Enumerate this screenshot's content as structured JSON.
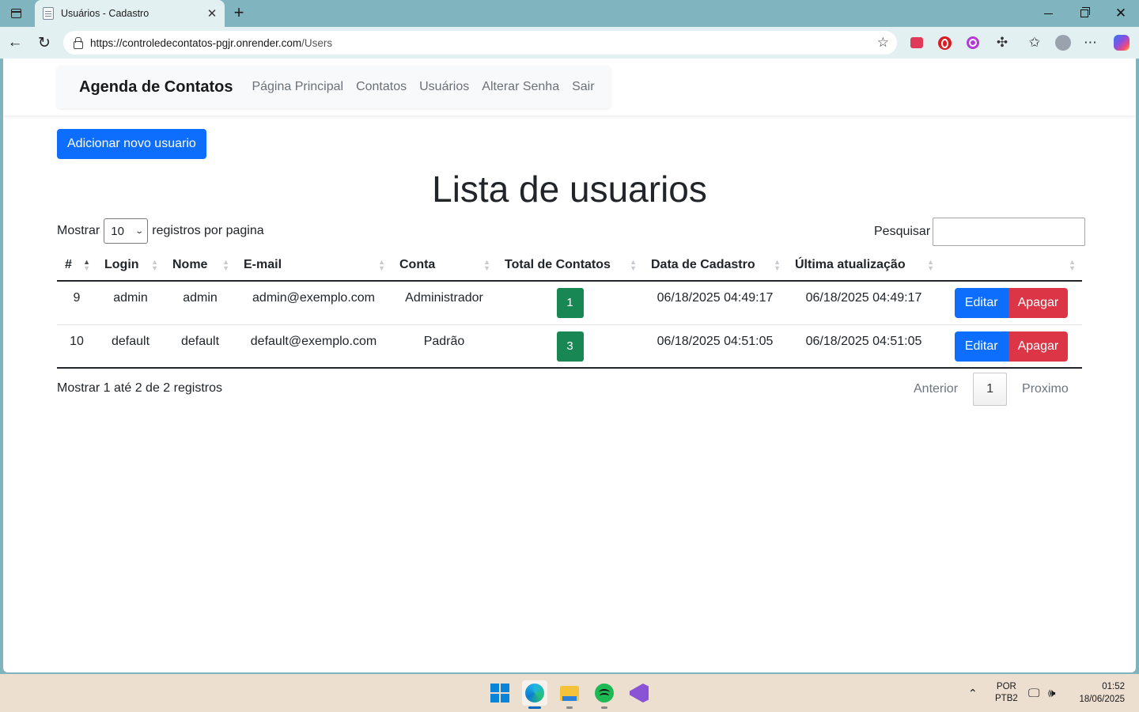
{
  "browser": {
    "tab_title": "Usuários - Cadastro",
    "url_host": "https://controledecontatos-pgjr.onrender.com",
    "url_path": "/Users"
  },
  "navbar": {
    "brand": "Agenda de Contatos",
    "links": [
      "Página Principal",
      "Contatos",
      "Usuários",
      "Alterar Senha",
      "Sair"
    ]
  },
  "main": {
    "add_button": "Adicionar novo usuario",
    "title": "Lista de usuarios",
    "length_prefix": "Mostrar",
    "length_value": "10",
    "length_suffix": "registros por pagina",
    "search_label": "Pesquisar",
    "search_value": ""
  },
  "table": {
    "headers": [
      "#",
      "Login",
      "Nome",
      "E-mail",
      "Conta",
      "Total de Contatos",
      "Data de Cadastro",
      "Última atualização",
      ""
    ],
    "rows": [
      {
        "id": "9",
        "login": "admin",
        "nome": "admin",
        "email": "admin@exemplo.com",
        "conta": "Administrador",
        "total": "1",
        "cadastro": "06/18/2025 04:49:17",
        "atualizacao": "06/18/2025 04:49:17",
        "edit": "Editar",
        "delete": "Apagar"
      },
      {
        "id": "10",
        "login": "default",
        "nome": "default",
        "email": "default@exemplo.com",
        "conta": "Padrão",
        "total": "3",
        "cadastro": "06/18/2025 04:51:05",
        "atualizacao": "06/18/2025 04:51:05",
        "edit": "Editar",
        "delete": "Apagar"
      }
    ]
  },
  "footer": {
    "info": "Mostrar 1 até 2 de 2 registros",
    "prev": "Anterior",
    "page": "1",
    "next": "Proximo"
  },
  "taskbar": {
    "lang_1": "POR",
    "lang_2": "PTB2",
    "time": "01:52",
    "date": "18/06/2025"
  },
  "colors": {
    "primary": "#0d6efd",
    "danger": "#dc3545",
    "success": "#198754"
  }
}
